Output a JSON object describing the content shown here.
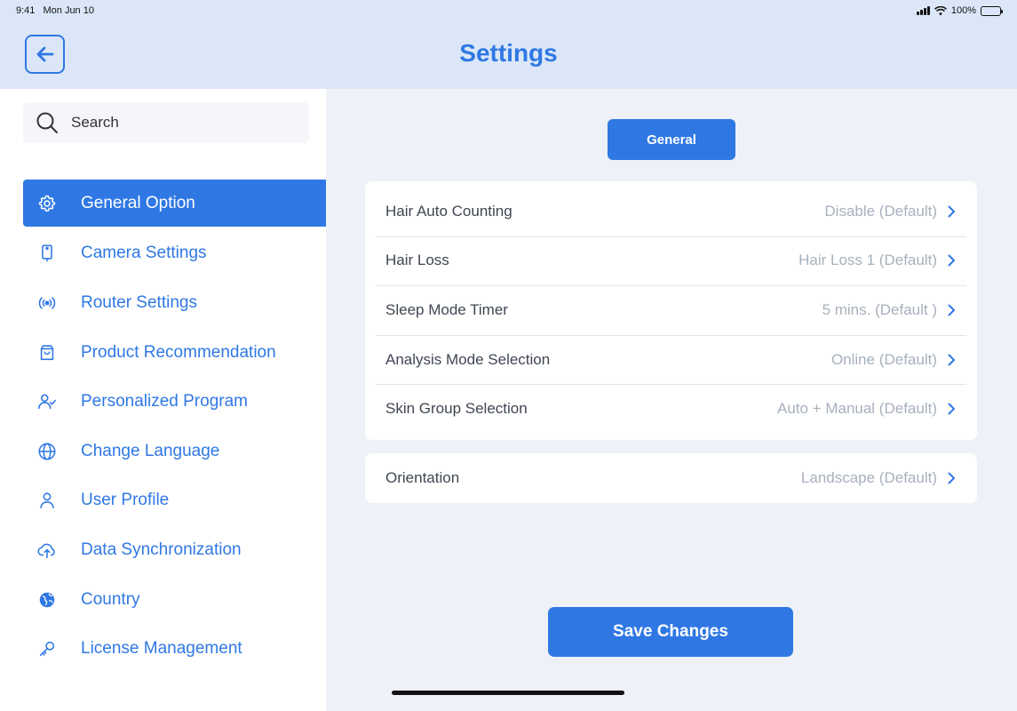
{
  "status_bar": {
    "time": "9:41",
    "date": "Mon Jun 10",
    "battery": "100%"
  },
  "header": {
    "title": "Settings"
  },
  "search": {
    "placeholder": "Search"
  },
  "sidebar": {
    "items": [
      {
        "label": "General Option",
        "icon": "gear-icon",
        "active": true
      },
      {
        "label": "Camera Settings",
        "icon": "tablet-camera-icon"
      },
      {
        "label": "Router Settings",
        "icon": "broadcast-icon"
      },
      {
        "label": "Product Recommendation",
        "icon": "shopping-bag-icon"
      },
      {
        "label": "Personalized Program",
        "icon": "user-check-icon"
      },
      {
        "label": "Change Language",
        "icon": "globe-icon"
      },
      {
        "label": "User Profile",
        "icon": "user-icon"
      },
      {
        "label": "Data Synchronization",
        "icon": "cloud-upload-icon"
      },
      {
        "label": "Country",
        "icon": "earth-icon"
      },
      {
        "label": "License Management",
        "icon": "key-icon"
      }
    ]
  },
  "main": {
    "tab_label": "General",
    "settings": [
      {
        "label": "Hair Auto Counting",
        "value": "Disable (Default)"
      },
      {
        "label": "Hair Loss",
        "value": "Hair Loss 1 (Default)"
      },
      {
        "label": "Sleep Mode Timer",
        "value": "5 mins. (Default )"
      },
      {
        "label": "Analysis Mode Selection",
        "value": "Online (Default)"
      },
      {
        "label": "Skin Group Selection",
        "value": "Auto + Manual (Default)"
      }
    ],
    "orientation": {
      "label": "Orientation",
      "value": "Landscape (Default)"
    },
    "save_label": "Save Changes"
  },
  "colors": {
    "accent": "#2f78e4",
    "header_bg": "#dbe7f8",
    "main_bg": "#eef1f7",
    "muted_text": "#a7b0bd"
  }
}
